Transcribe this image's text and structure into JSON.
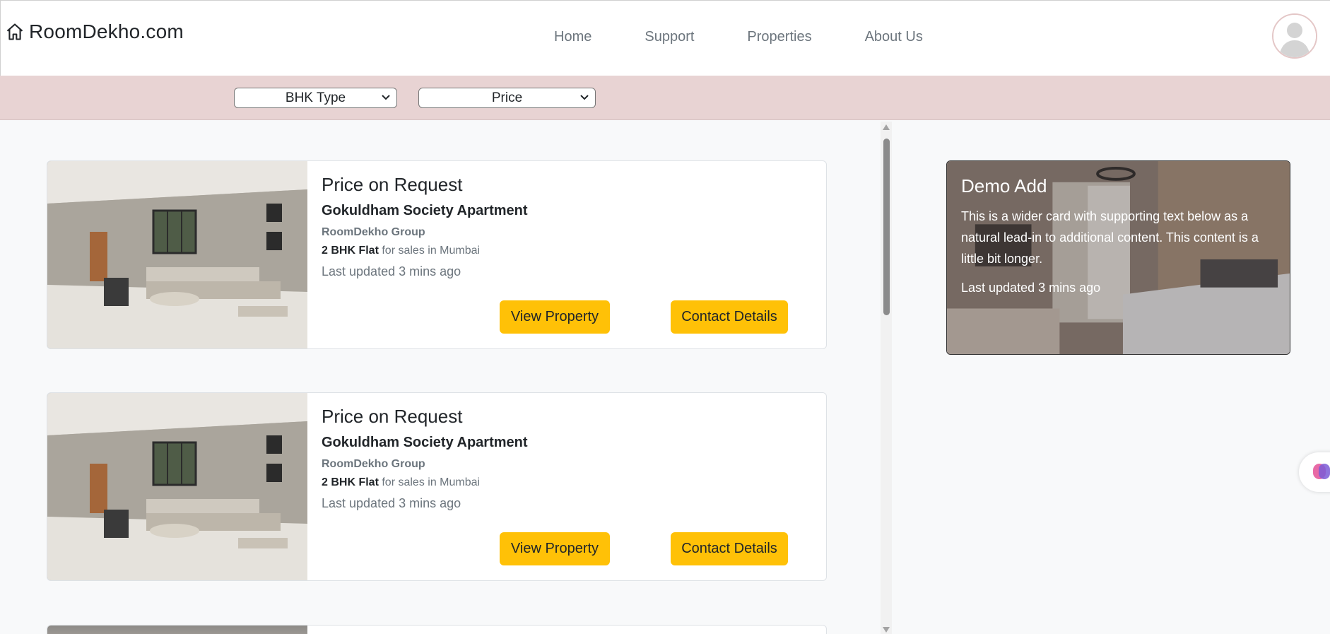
{
  "header": {
    "brand": "RoomDekho.com",
    "brand_icon": "home-icon",
    "nav": [
      {
        "label": "Home"
      },
      {
        "label": "Support"
      },
      {
        "label": "Properties"
      },
      {
        "label": "About Us"
      }
    ],
    "avatar_icon": "user-avatar-icon"
  },
  "filters": {
    "bhk": {
      "selected": "BHK Type"
    },
    "price": {
      "selected": "Price"
    }
  },
  "listings": [
    {
      "price": "Price on Request",
      "title": "Gokuldham Society Apartment",
      "group": "RoomDekho Group",
      "flat_type": "2 BHK Flat",
      "flat_suffix": "for sales in Mumbai",
      "updated": "Last updated 3 mins ago",
      "view_label": "View Property",
      "contact_label": "Contact Details"
    },
    {
      "price": "Price on Request",
      "title": "Gokuldham Society Apartment",
      "group": "RoomDekho Group",
      "flat_type": "2 BHK Flat",
      "flat_suffix": "for sales in Mumbai",
      "updated": "Last updated 3 mins ago",
      "view_label": "View Property",
      "contact_label": "Contact Details"
    }
  ],
  "ad": {
    "title": "Demo Add",
    "text": "This is a wider card with supporting text below as a natural lead-in to additional content. This content is a little bit longer.",
    "updated": "Last updated 3 mins ago"
  },
  "colors": {
    "accent": "#ffc107",
    "filter_bar": "#e8d3d3",
    "page_bg": "#f8f9fa"
  }
}
